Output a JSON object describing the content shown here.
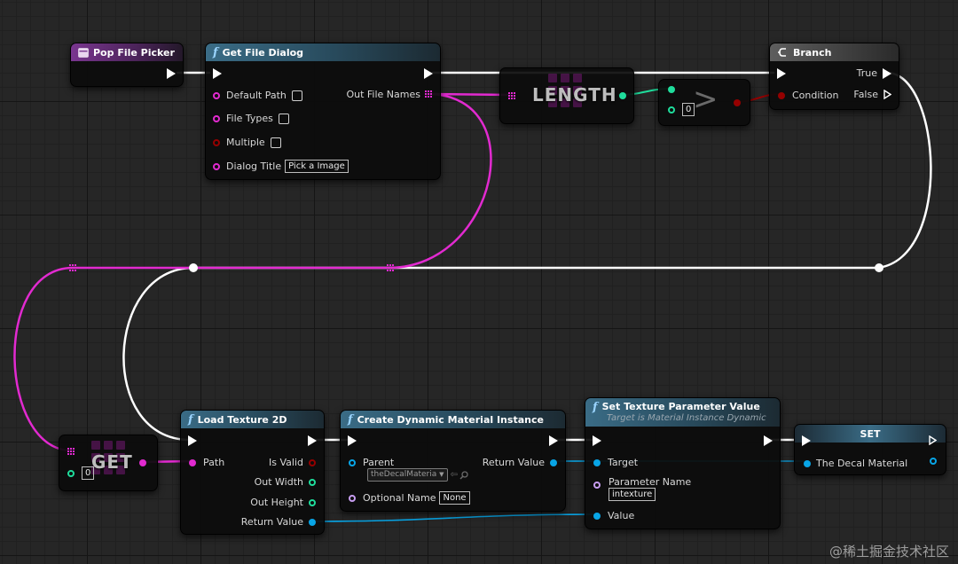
{
  "nodes": {
    "pop_file_picker": {
      "title": "Pop File Picker"
    },
    "get_file_dialog": {
      "title": "Get File Dialog",
      "pins": {
        "default_path": "Default Path",
        "file_types": "File Types",
        "multiple": "Multiple",
        "dialog_title": "Dialog Title",
        "dialog_title_value": "Pick a Image",
        "out_file_names": "Out File Names"
      }
    },
    "length": {
      "title": "LENGTH"
    },
    "greater": {
      "symbol": ">",
      "input_value": "0"
    },
    "branch": {
      "title": "Branch",
      "pins": {
        "condition": "Condition",
        "true": "True",
        "false": "False"
      }
    },
    "get": {
      "title": "GET",
      "index_value": "0"
    },
    "load_texture_2d": {
      "title": "Load Texture 2D",
      "pins": {
        "path": "Path",
        "is_valid": "Is Valid",
        "out_width": "Out Width",
        "out_height": "Out Height",
        "return_value": "Return Value"
      }
    },
    "create_dmi": {
      "title": "Create Dynamic Material Instance",
      "pins": {
        "parent": "Parent",
        "parent_value": "theDecalMateria",
        "optional_name": "Optional Name",
        "optional_name_value": "None",
        "return_value": "Return Value"
      }
    },
    "set_texture_param": {
      "title": "Set Texture Parameter Value",
      "subtitle": "Target is Material Instance Dynamic",
      "pins": {
        "target": "Target",
        "parameter_name": "Parameter Name",
        "parameter_name_value": "intexture",
        "value": "Value"
      }
    },
    "set": {
      "title": "SET",
      "pins": {
        "the_decal_material": "The Decal Material"
      }
    }
  },
  "watermark": "@稀土掘金技术社区",
  "colors": {
    "exec": "#ffffff",
    "string": "#e22ad0",
    "integer": "#1fdd9c",
    "boolean": "#950000",
    "object": "#08a5e6",
    "name": "#c79df0",
    "function_header": "#3a6c86",
    "event_header": "#7a3690"
  },
  "icons": [
    "function-icon",
    "event-icon",
    "branch-icon",
    "exec-pin-icon",
    "array-pin-icon",
    "dropdown-arrow-icon",
    "search-icon"
  ]
}
